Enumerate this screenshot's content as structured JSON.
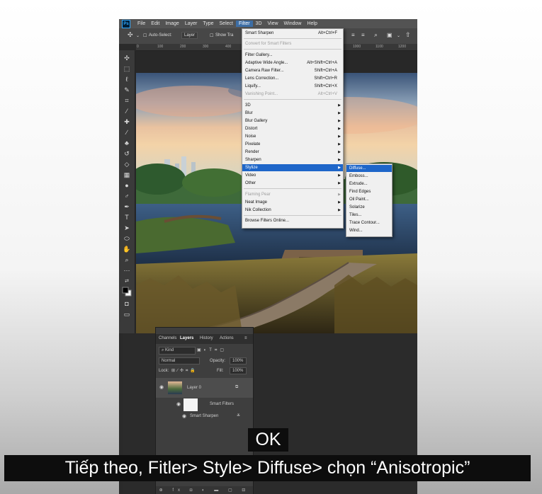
{
  "menubar": {
    "logo": "Ps",
    "items": [
      "File",
      "Edit",
      "Image",
      "Layer",
      "Type",
      "Select",
      "Filter",
      "3D",
      "View",
      "Window",
      "Help"
    ],
    "active": "Filter"
  },
  "options_bar": {
    "auto_select_label": "Auto-Select:",
    "auto_select_value": "Layer",
    "show_transform_label": "Show Tra"
  },
  "ruler": {
    "ticks": [
      "0",
      "100",
      "200",
      "300",
      "400",
      "1000",
      "1100",
      "1200"
    ]
  },
  "filter_menu": {
    "items": [
      {
        "label": "Smart Sharpen",
        "shortcut": "Alt+Ctrl+F",
        "disabled": false
      },
      {
        "label": "Convert for Smart Filters",
        "shortcut": "",
        "disabled": true
      },
      {
        "label": "Filter Gallery...",
        "shortcut": "",
        "disabled": false
      },
      {
        "label": "Adaptive Wide Angle...",
        "shortcut": "Alt+Shift+Ctrl+A",
        "disabled": false
      },
      {
        "label": "Camera Raw Filter...",
        "shortcut": "Shift+Ctrl+A",
        "disabled": false
      },
      {
        "label": "Lens Correction...",
        "shortcut": "Shift+Ctrl+R",
        "disabled": false
      },
      {
        "label": "Liquify...",
        "shortcut": "Shift+Ctrl+X",
        "disabled": false
      },
      {
        "label": "Vanishing Point...",
        "shortcut": "Alt+Ctrl+V",
        "disabled": true
      },
      {
        "label": "3D",
        "submenu": true
      },
      {
        "label": "Blur",
        "submenu": true
      },
      {
        "label": "Blur Gallery",
        "submenu": true
      },
      {
        "label": "Distort",
        "submenu": true
      },
      {
        "label": "Noise",
        "submenu": true
      },
      {
        "label": "Pixelate",
        "submenu": true
      },
      {
        "label": "Render",
        "submenu": true
      },
      {
        "label": "Sharpen",
        "submenu": true
      },
      {
        "label": "Stylize",
        "submenu": true,
        "highlighted": true
      },
      {
        "label": "Video",
        "submenu": true
      },
      {
        "label": "Other",
        "submenu": true
      },
      {
        "label": "Flaming Pear",
        "submenu": true,
        "disabled": true
      },
      {
        "label": "Neat Image",
        "submenu": true
      },
      {
        "label": "Nik Collection",
        "submenu": true
      },
      {
        "label": "Browse Filters Online...",
        "shortcut": ""
      }
    ]
  },
  "stylize_submenu": {
    "items": [
      "Diffuse...",
      "Emboss...",
      "Extrude...",
      "Find Edges",
      "Oil Paint...",
      "Solarize",
      "Tiles...",
      "Trace Contour...",
      "Wind..."
    ],
    "highlighted": "Diffuse..."
  },
  "layers_panel": {
    "tabs": [
      "Channels",
      "Layers",
      "History",
      "Actions"
    ],
    "active_tab": "Layers",
    "kind_filter": "Kind",
    "blend_mode": "Normal",
    "opacity_label": "Opacity:",
    "opacity_value": "100%",
    "lock_label": "Lock:",
    "fill_label": "Fill:",
    "fill_value": "100%",
    "layer_name": "Layer 0",
    "smart_filters_label": "Smart Filters",
    "smart_filter_item": "Smart Sharpen"
  },
  "captions": {
    "ok": "OK",
    "main": "Tiếp theo, Fitler> Style> Diffuse> chọn “Anisotropic”"
  }
}
